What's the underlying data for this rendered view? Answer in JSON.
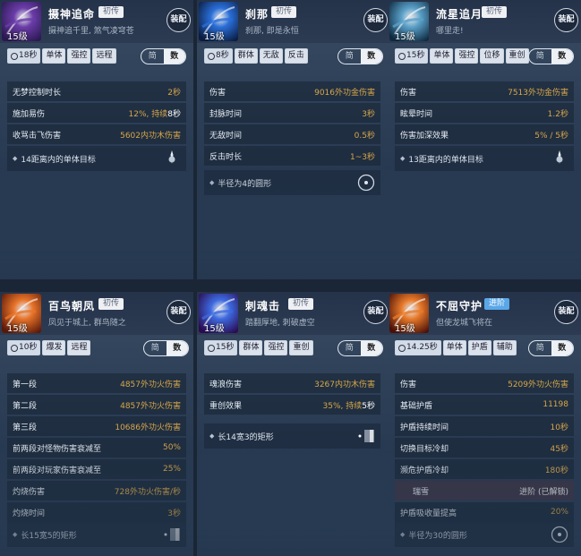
{
  "cards": [
    {
      "name": "摄神追命",
      "tag": "初传",
      "level": "15级",
      "desc": "摄神追千里, 煞气凌穹苍",
      "equip": "装配",
      "cd": "18秒",
      "chips": [
        "单体",
        "强控",
        "远程"
      ],
      "toggle": [
        "简",
        "数"
      ],
      "stats": [
        {
          "k": "无梦控制时长",
          "v": "2秒"
        },
        {
          "k": "施加易伤",
          "v": "12%, 持续",
          "v2": "8秒"
        },
        {
          "k": "收骂击飞伤害",
          "v": "5602内功木伤害"
        }
      ],
      "range": "14距离内的单体目标",
      "icon": "spear-range-icon"
    },
    {
      "name": "刹那",
      "tag": "初传",
      "level": "15级",
      "desc": "刹那, 即是永恒",
      "equip": "装配",
      "cd": "8秒",
      "chips": [
        "群体",
        "无敌",
        "反击"
      ],
      "toggle": [
        "简",
        "数"
      ],
      "stats": [
        {
          "k": "伤害",
          "v": "9016外功金伤害"
        },
        {
          "k": "封脉时间",
          "v": "3秒"
        },
        {
          "k": "无敌时间",
          "v": "0.5秒"
        },
        {
          "k": "反击时长",
          "v": "1~3秒"
        }
      ],
      "range": "半径为4的圆形",
      "icon": "circle-range-icon"
    },
    {
      "name": "流星追月",
      "tag": "初传",
      "level": "15级",
      "desc": "哪里走!",
      "equip": "装配",
      "cd": "15秒",
      "chips": [
        "单体",
        "强控",
        "位移",
        "重创"
      ],
      "toggle": [
        "简",
        "数"
      ],
      "stats": [
        {
          "k": "伤害",
          "v": "7513外功金伤害"
        },
        {
          "k": "眩晕时间",
          "v": "1.2秒"
        },
        {
          "k": "伤害加深效果",
          "v": "5% / 5秒"
        }
      ],
      "range": "13距离内的单体目标",
      "icon": "spear-range-icon"
    },
    {
      "name": "百鸟朝凤",
      "tag": "初传",
      "level": "15级",
      "desc": "凤见于城上, 群鸟随之",
      "equip": "装配",
      "cd": "10秒",
      "chips": [
        "爆发",
        "远程"
      ],
      "toggle": [
        "简",
        "数"
      ],
      "stats": [
        {
          "k": "第一段",
          "v": "4857外功火伤害"
        },
        {
          "k": "第二段",
          "v": "4857外功火伤害"
        },
        {
          "k": "第三段",
          "v": "10686外功火伤害"
        },
        {
          "k": "前两段对怪物伤害衰减至",
          "v": "50%"
        },
        {
          "k": "前两段对玩家伤害衰减至",
          "v": "25%"
        },
        {
          "k": "灼烧伤害",
          "v": "728外功火伤害/秒"
        },
        {
          "k": "灼烧时间",
          "v": "3秒"
        }
      ],
      "range": "长15宽5的矩形",
      "icon": "rect-range-icon"
    },
    {
      "name": "刺魂击",
      "tag": "初传",
      "level": "15级",
      "desc": "踏翻厚地, 刺破虚空",
      "equip": "装配",
      "cd": "15秒",
      "chips": [
        "群体",
        "强控",
        "重创"
      ],
      "toggle": [
        "简",
        "数"
      ],
      "stats": [
        {
          "k": "魂浪伤害",
          "v": "3267内功木伤害"
        },
        {
          "k": "重创效果",
          "v": "35%, 持续",
          "v2": "5秒"
        }
      ],
      "range": "长14宽3的矩形",
      "icon": "rect-range-icon"
    },
    {
      "name": "不屈守护",
      "tag": "进阶",
      "level": "15级",
      "desc": "但使龙城飞将在",
      "equip": "装配",
      "cd": "14.25秒",
      "chips": [
        "单体",
        "护盾",
        "辅助"
      ],
      "toggle": [
        "简",
        "数"
      ],
      "stats": [
        {
          "k": "伤害",
          "v": "5209外功火伤害"
        },
        {
          "k": "基础护盾",
          "v": "11198"
        },
        {
          "k": "护盾持续时间",
          "v": "10秒"
        },
        {
          "k": "切换目标冷却",
          "v": "45秒"
        },
        {
          "k": "濒危护盾冷却",
          "v": "180秒"
        },
        {
          "k": "瑞雪",
          "v": "进阶 (已解锁)",
          "sub": true
        },
        {
          "k": "护盾吸收量提高",
          "v": "20%"
        }
      ],
      "range": "半径为30的圆形",
      "icon": "circle-range-icon"
    }
  ]
}
